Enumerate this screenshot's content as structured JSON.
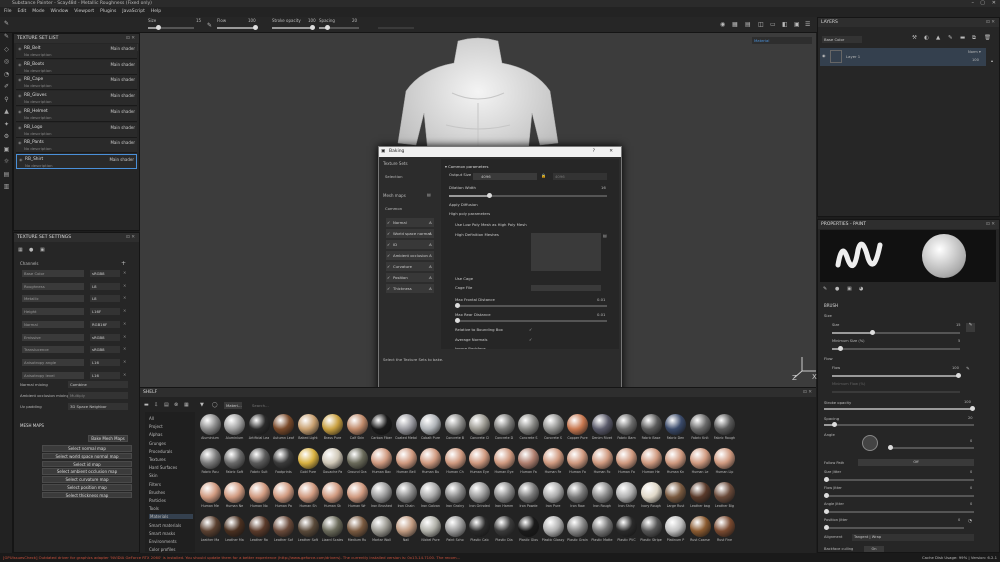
{
  "window": {
    "title": "Substance Painter - Scay48d - Metallic Roughness (Fixed only)"
  },
  "menu": [
    "File",
    "Edit",
    "Mode",
    "Window",
    "Viewport",
    "Plugins",
    "JavaScript",
    "Help"
  ],
  "toolbar": {
    "size_label": "Size",
    "size_value": "15",
    "flow_label": "Flow",
    "flow_value": "100",
    "stroke_label": "Stroke opacity",
    "stroke_value": "100",
    "spacing_label": "Spacing",
    "spacing_value": "20",
    "material_select": "Material"
  },
  "texture_set_list": {
    "title": "TEXTURE SET LIST",
    "settings": "Settings ▾",
    "items": [
      {
        "name": "RB_Belt",
        "desc": "No description",
        "shader": "Main shader"
      },
      {
        "name": "RB_Boots",
        "desc": "No description",
        "shader": "Main shader"
      },
      {
        "name": "RB_Cape",
        "desc": "No description",
        "shader": "Main shader"
      },
      {
        "name": "RB_Gloves",
        "desc": "No description",
        "shader": "Main shader"
      },
      {
        "name": "RB_Helmet",
        "desc": "No description",
        "shader": "Main shader"
      },
      {
        "name": "RB_Logo",
        "desc": "No description",
        "shader": "Main shader"
      },
      {
        "name": "RB_Pants",
        "desc": "No description",
        "shader": "Main shader"
      },
      {
        "name": "RB_Shirt",
        "desc": "No description",
        "shader": "Main shader"
      }
    ]
  },
  "texture_set_settings": {
    "title": "TEXTURE SET SETTINGS",
    "channels_label": "Channels",
    "channels": [
      {
        "name": "Base Color",
        "value": "sRGB8"
      },
      {
        "name": "Roughness",
        "value": "L8"
      },
      {
        "name": "Metallic",
        "value": "L8"
      },
      {
        "name": "Height",
        "value": "L16F"
      },
      {
        "name": "Normal",
        "value": "RGB16F"
      },
      {
        "name": "Emissive",
        "value": "sRGB8"
      },
      {
        "name": "Translucence",
        "value": "sRGB8"
      },
      {
        "name": "Anisotropy angle",
        "value": "L16"
      },
      {
        "name": "Anisotropy level",
        "value": "L16"
      }
    ],
    "normal_mixing_label": "Normal mixing",
    "normal_mixing": "Combine",
    "ao_mixing_label": "Ambient occlusion mixing",
    "ao_mixing": "Multiply",
    "uv_padding_label": "Uv padding",
    "uv_padding": "3D Space Neighbor",
    "mesh_maps_label": "MESH MAPS",
    "bake_button": "Bake Mesh Maps",
    "map_buttons": [
      "Select normal map",
      "Select world space normal map",
      "Select id map",
      "Select ambient occlusion map",
      "Select curvature map",
      "Select position map",
      "Select thickness map"
    ]
  },
  "baking": {
    "title": "Baking",
    "texture_sets_label": "Texture Sets",
    "selection": "Selection",
    "mesh_maps_label": "Mesh maps",
    "common": "Common",
    "maps": [
      "Normal",
      "World space normal",
      "ID",
      "Ambient occlusion",
      "Curvature",
      "Position",
      "Thickness"
    ],
    "common_params": "Common parameters",
    "output_size_label": "Output Size",
    "output_size": "4096",
    "output_size2": "4096",
    "dilation_label": "Dilation Width",
    "dilation_value": "16",
    "apply_diffusion": "Apply Diffusion",
    "high_poly_params": "High poly parameters",
    "use_low_poly": "Use Low Poly Mesh as High Poly Mesh",
    "high_def_meshes": "High Definition Meshes",
    "use_cage": "Use Cage",
    "cage_file": "Cage File",
    "max_frontal_label": "Max Frontal Distance",
    "max_frontal": "0.01",
    "max_rear_label": "Max Rear Distance",
    "max_rear": "0.01",
    "relative_bbox": "Relative to Bounding Box",
    "average_normals": "Average Normals",
    "ignore_backface": "Ignore Backface",
    "hint": "Select the Texture Sets to bake.",
    "disable_help": "Disable help",
    "selected_count": "8 textures selected for baking",
    "cancel": "Cancel",
    "bake_selected": "Bake selected textures"
  },
  "shelf": {
    "title": "SHELF",
    "search_tag": "Materi...",
    "search_placeholder": "Search...",
    "categories": [
      "All",
      "Project",
      "Alphas",
      "Grunges",
      "Procedurals",
      "Textures",
      "Hard Surfaces",
      "Skin",
      "Filters",
      "Brushes",
      "Particles",
      "Tools",
      "Materials",
      "Smart materials",
      "Smart masks",
      "Environments",
      "Color profiles"
    ],
    "materials": [
      {
        "name": "Aluminium",
        "color": "#8a8a8a"
      },
      {
        "name": "Aluminium",
        "color": "#a0a0a0"
      },
      {
        "name": "Artificial Lea",
        "color": "#2a2a2a"
      },
      {
        "name": "Autumn Leaf",
        "color": "#7a4a2a"
      },
      {
        "name": "Baked Light",
        "color": "#c8a070"
      },
      {
        "name": "Brass Pure",
        "color": "#c9a040"
      },
      {
        "name": "Calf Skin",
        "color": "#c08a6a"
      },
      {
        "name": "Carbon Fiber",
        "color": "#1a1a1a"
      },
      {
        "name": "Coated Metal",
        "color": "#9a9aa0"
      },
      {
        "name": "Cobalt Pure",
        "color": "#b0b4b8"
      },
      {
        "name": "Concrete B",
        "color": "#8a8a88"
      },
      {
        "name": "Concrete Cl",
        "color": "#9a9890"
      },
      {
        "name": "Concrete D",
        "color": "#7a7a78"
      },
      {
        "name": "Concrete S",
        "color": "#888885"
      },
      {
        "name": "Concrete S",
        "color": "#929290"
      },
      {
        "name": "Copper Pure",
        "color": "#c87850"
      },
      {
        "name": "Denim Rivet",
        "color": "#5a5a6a"
      },
      {
        "name": "Fabric Bam",
        "color": "#6a6a6a"
      },
      {
        "name": "Fabric Base",
        "color": "#5a5a5a"
      },
      {
        "name": "Fabric Den",
        "color": "#3a4a6a"
      },
      {
        "name": "Fabric Knit",
        "color": "#6a6a6a"
      },
      {
        "name": "Fabric Rough",
        "color": "#5a5a5a"
      },
      {
        "name": "Fabric Rou",
        "color": "#7a7a7a"
      },
      {
        "name": "Fabric Soft",
        "color": "#6a6a6a"
      },
      {
        "name": "Fabric Suit",
        "color": "#5a5a5a"
      },
      {
        "name": "Footprints",
        "color": "#3a3a3a"
      },
      {
        "name": "Gold Pure",
        "color": "#d8b040"
      },
      {
        "name": "Gouache Pa",
        "color": "#d0c8b8"
      },
      {
        "name": "Ground Gra",
        "color": "#6a6a5a"
      },
      {
        "name": "Human Bac",
        "color": "#d09a80"
      },
      {
        "name": "Human Bell",
        "color": "#d09a80"
      },
      {
        "name": "Human Bu",
        "color": "#d09a80"
      },
      {
        "name": "Human Ch",
        "color": "#d09a80"
      },
      {
        "name": "Human Eye",
        "color": "#d09a80"
      },
      {
        "name": "Human Eye",
        "color": "#d09a80"
      },
      {
        "name": "Human Fa",
        "color": "#b08070"
      },
      {
        "name": "Human Fe",
        "color": "#d09a80"
      },
      {
        "name": "Human Fo",
        "color": "#d09a80"
      },
      {
        "name": "Human Fo",
        "color": "#d09a80"
      },
      {
        "name": "Human Fo",
        "color": "#d09a80"
      },
      {
        "name": "Human He",
        "color": "#d09a80"
      },
      {
        "name": "Human Kn",
        "color": "#d09a80"
      },
      {
        "name": "Human Le",
        "color": "#d09a80"
      },
      {
        "name": "Human Lip",
        "color": "#d09a80"
      },
      {
        "name": "Human Me",
        "color": "#d09a80"
      },
      {
        "name": "Human Ne",
        "color": "#d09a80"
      },
      {
        "name": "Human No",
        "color": "#d09a80"
      },
      {
        "name": "Human Pa",
        "color": "#d09a80"
      },
      {
        "name": "Human Sh",
        "color": "#d09a80"
      },
      {
        "name": "Human Sk",
        "color": "#d09a80"
      },
      {
        "name": "Human Wr",
        "color": "#d09a80"
      },
      {
        "name": "Iron Brushed",
        "color": "#9a9a9a"
      },
      {
        "name": "Iron Chain",
        "color": "#8a8a8a"
      },
      {
        "name": "Iron Galvan",
        "color": "#a8a8a8"
      },
      {
        "name": "Iron Grainy",
        "color": "#888"
      },
      {
        "name": "Iron Grinded",
        "color": "#9a9a9a"
      },
      {
        "name": "Iron Hamm",
        "color": "#8a8a8a"
      },
      {
        "name": "Iron Powde",
        "color": "#7a7a7a"
      },
      {
        "name": "Iron Pure",
        "color": "#aaa"
      },
      {
        "name": "Iron Raw",
        "color": "#7a7a7a"
      },
      {
        "name": "Iron Rough",
        "color": "#8a8a8a"
      },
      {
        "name": "Iron Shiny",
        "color": "#b0b0b0"
      },
      {
        "name": "Ivory Rough",
        "color": "#e0d8c8"
      },
      {
        "name": "Large Rust",
        "color": "#7a5a40"
      },
      {
        "name": "Leather bag",
        "color": "#5a3a2a"
      },
      {
        "name": "Leather Big",
        "color": "#6a4a3a"
      },
      {
        "name": "Leather Ma",
        "color": "#5a4030"
      },
      {
        "name": "Leather Ma",
        "color": "#4a3020"
      },
      {
        "name": "Leather Ro",
        "color": "#5a3a2a"
      },
      {
        "name": "Leather Sof",
        "color": "#6a4a3a"
      },
      {
        "name": "Leather Soft",
        "color": "#5a4a3a"
      },
      {
        "name": "Lizard Scales",
        "color": "#6a6a5a"
      },
      {
        "name": "Medium Ru",
        "color": "#7a5a40"
      },
      {
        "name": "Mortar Wall",
        "color": "#9a9890"
      },
      {
        "name": "Nail",
        "color": "#c09a80"
      },
      {
        "name": "Nickel Pure",
        "color": "#b0b0a8"
      },
      {
        "name": "Paint Scho",
        "color": "#9a9a9a"
      },
      {
        "name": "Plastic Cab",
        "color": "#2a2a2a"
      },
      {
        "name": "Plastic Dia",
        "color": "#3a3a3a"
      },
      {
        "name": "Plastic Glos",
        "color": "#1a1a1a"
      },
      {
        "name": "Plastic Glossy",
        "color": "#b0b0b0"
      },
      {
        "name": "Plastic Grain",
        "color": "#888"
      },
      {
        "name": "Plastic Matte",
        "color": "#777"
      },
      {
        "name": "Plastic PVC",
        "color": "#2a2a2a"
      },
      {
        "name": "Plastic Stripe",
        "color": "#555"
      },
      {
        "name": "Platinum P",
        "color": "#c0c0c0"
      },
      {
        "name": "Rust Coarse",
        "color": "#8a5a30"
      },
      {
        "name": "Rust Fine",
        "color": "#7a4a30"
      }
    ]
  },
  "layers": {
    "title": "LAYERS",
    "channel_select": "Base Color",
    "blend_mode": "Norm ▾",
    "layer_name": "Layer 1",
    "opacity": "100"
  },
  "properties": {
    "title": "PROPERTIES - PAINT",
    "brush_label": "BRUSH",
    "size_section": "Size",
    "size_label": "Size",
    "size_value": "15",
    "min_size_label": "Minimum Size (%)",
    "min_size_value": "5",
    "flow_section": "Flow",
    "flow_label": "Flow",
    "flow_value": "100",
    "min_flow_label": "Minimum Flow (%)",
    "stroke_label": "Stroke opacity",
    "stroke_value": "100",
    "spacing_label": "Spacing",
    "spacing_value": "20",
    "angle_label": "Angle",
    "angle_value": "0",
    "follow_path_label": "Follow Path",
    "follow_path_value": "Off",
    "size_jitter_label": "Size Jitter",
    "size_jitter_value": "0",
    "flow_jitter_label": "Flow Jitter",
    "flow_jitter_value": "0",
    "angle_jitter_label": "Angle Jitter",
    "angle_jitter_value": "0",
    "position_jitter_label": "Position Jitter",
    "position_jitter_value": "0",
    "alignment_label": "Alignment",
    "alignment_value": "Tangent | Wrap",
    "backface_label": "Backface culling",
    "backface_value": "On"
  },
  "status": {
    "message": "[GPUIssuesCheck] Outdated driver for graphics adapter 'NVIDIA GeForce RTX 2060' is installed. You should update them for a better experience (http://www.geforce.com/drivers). The currently installed version is: 0x13-14.7100. The recom...",
    "cache": "Cache Disk Usage:",
    "cache_value": "99%",
    "version": "Version: 6.2.1"
  },
  "colors": {
    "accent": "#4a90d9",
    "bg": "#1d1d1d",
    "panel": "#262626",
    "error": "#c9503b"
  }
}
